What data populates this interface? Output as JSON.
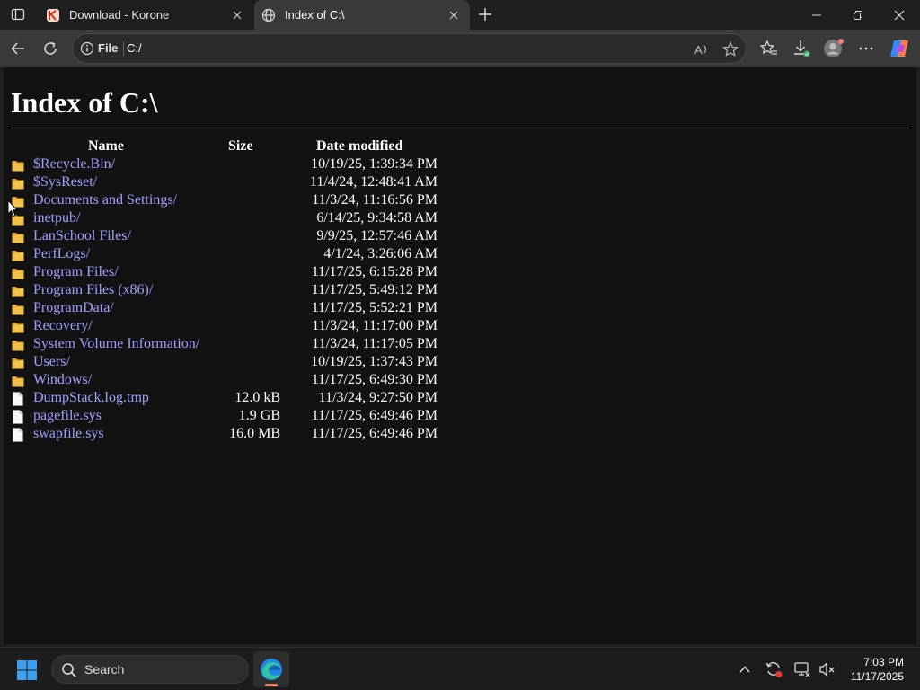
{
  "tabs": [
    {
      "title": "Download - Korone",
      "active": false
    },
    {
      "title": "Index of C:\\",
      "active": true
    }
  ],
  "toolbar": {
    "scheme_label": "File",
    "url": "C:/"
  },
  "page": {
    "heading": "Index of C:\\",
    "columns": {
      "name": "Name",
      "size": "Size",
      "date": "Date modified"
    },
    "entries": [
      {
        "type": "folder",
        "name": "$Recycle.Bin/",
        "size": "",
        "date": "10/19/25, 1:39:34 PM"
      },
      {
        "type": "folder",
        "name": "$SysReset/",
        "size": "",
        "date": "11/4/24, 12:48:41 AM"
      },
      {
        "type": "folder",
        "name": "Documents and Settings/",
        "size": "",
        "date": "11/3/24, 11:16:56 PM"
      },
      {
        "type": "folder",
        "name": "inetpub/",
        "size": "",
        "date": "6/14/25, 9:34:58 AM"
      },
      {
        "type": "folder",
        "name": "LanSchool Files/",
        "size": "",
        "date": "9/9/25, 12:57:46 AM"
      },
      {
        "type": "folder",
        "name": "PerfLogs/",
        "size": "",
        "date": "4/1/24, 3:26:06 AM"
      },
      {
        "type": "folder",
        "name": "Program Files/",
        "size": "",
        "date": "11/17/25, 6:15:28 PM"
      },
      {
        "type": "folder",
        "name": "Program Files (x86)/",
        "size": "",
        "date": "11/17/25, 5:49:12 PM"
      },
      {
        "type": "folder",
        "name": "ProgramData/",
        "size": "",
        "date": "11/17/25, 5:52:21 PM"
      },
      {
        "type": "folder",
        "name": "Recovery/",
        "size": "",
        "date": "11/3/24, 11:17:00 PM"
      },
      {
        "type": "folder",
        "name": "System Volume Information/",
        "size": "",
        "date": "11/3/24, 11:17:05 PM"
      },
      {
        "type": "folder",
        "name": "Users/",
        "size": "",
        "date": "10/19/25, 1:37:43 PM"
      },
      {
        "type": "folder",
        "name": "Windows/",
        "size": "",
        "date": "11/17/25, 6:49:30 PM"
      },
      {
        "type": "file",
        "name": "DumpStack.log.tmp",
        "size": "12.0 kB",
        "date": "11/3/24, 9:27:50 PM"
      },
      {
        "type": "file",
        "name": "pagefile.sys",
        "size": "1.9 GB",
        "date": "11/17/25, 6:49:46 PM"
      },
      {
        "type": "file",
        "name": "swapfile.sys",
        "size": "16.0 MB",
        "date": "11/17/25, 6:49:46 PM"
      }
    ]
  },
  "taskbar": {
    "search_label": "Search",
    "time": "7:03 PM",
    "date": "11/17/2025"
  },
  "colors": {
    "link": "#a0a0ff",
    "page_bg": "#121212",
    "folder": "#f2c14e",
    "accent": "#f0825a"
  },
  "icons": [
    "tab-actions-icon",
    "korone-favicon-icon",
    "globe-icon",
    "close-icon",
    "plus-icon",
    "minimize-icon",
    "restore-icon",
    "back-icon",
    "refresh-icon",
    "info-icon",
    "read-aloud-icon",
    "star-icon",
    "favorites-icon",
    "downloads-icon",
    "profile-icon",
    "more-icon",
    "copilot-icon",
    "folder-icon",
    "file-icon",
    "windows-start-icon",
    "search-icon",
    "edge-icon",
    "chevron-up-icon",
    "sync-icon",
    "display-icon",
    "network-muted-icon"
  ]
}
